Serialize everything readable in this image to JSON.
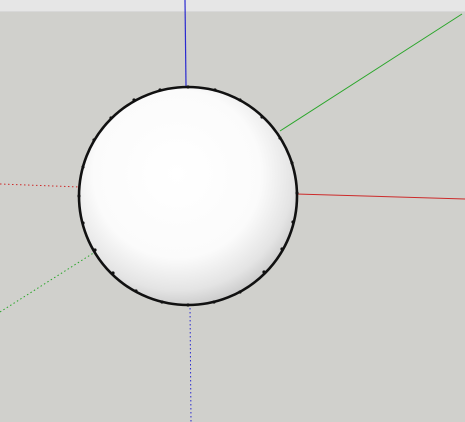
{
  "viewport": {
    "background": "#d0d0cc",
    "top_strip_color": "#e6e6e6"
  },
  "axes": {
    "x_color": "#cc2a2a",
    "y_color": "#2aa62a",
    "z_color": "#2a2ad0"
  },
  "model": {
    "shape": "sphere",
    "edge_color": "#111111",
    "fill_highlight": "#ffffff",
    "fill_shadow": "#c9c9c9"
  }
}
